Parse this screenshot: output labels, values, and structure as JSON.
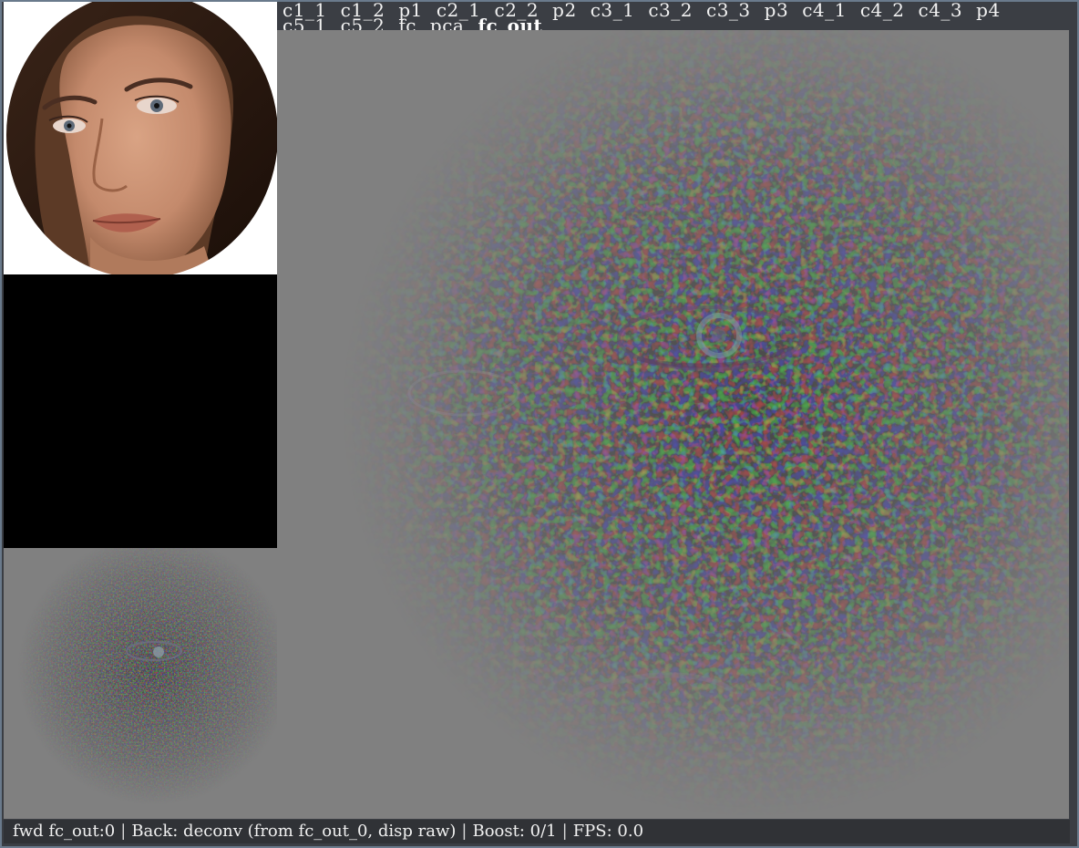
{
  "layers": {
    "row1": [
      "c1_1",
      "c1_2",
      "p1",
      "c2_1",
      "c2_2",
      "p2",
      "c3_1",
      "c3_2",
      "c3_3",
      "p3",
      "c4_1",
      "c4_2",
      "c4_3",
      "p4"
    ],
    "row2": [
      "c5_1",
      "c5_2",
      "fc",
      "pca",
      "fc_out"
    ],
    "selected": "fc_out"
  },
  "status": {
    "forward": "fwd fc_out:0",
    "back": "Back: deconv (from fc_out_0, disp raw)",
    "boost": "Boost: 0/1",
    "fps": "FPS: 0.0"
  },
  "colors": {
    "panel_gray": "#808080",
    "window_bg": "#3b3e44",
    "status_bg": "#303236"
  }
}
